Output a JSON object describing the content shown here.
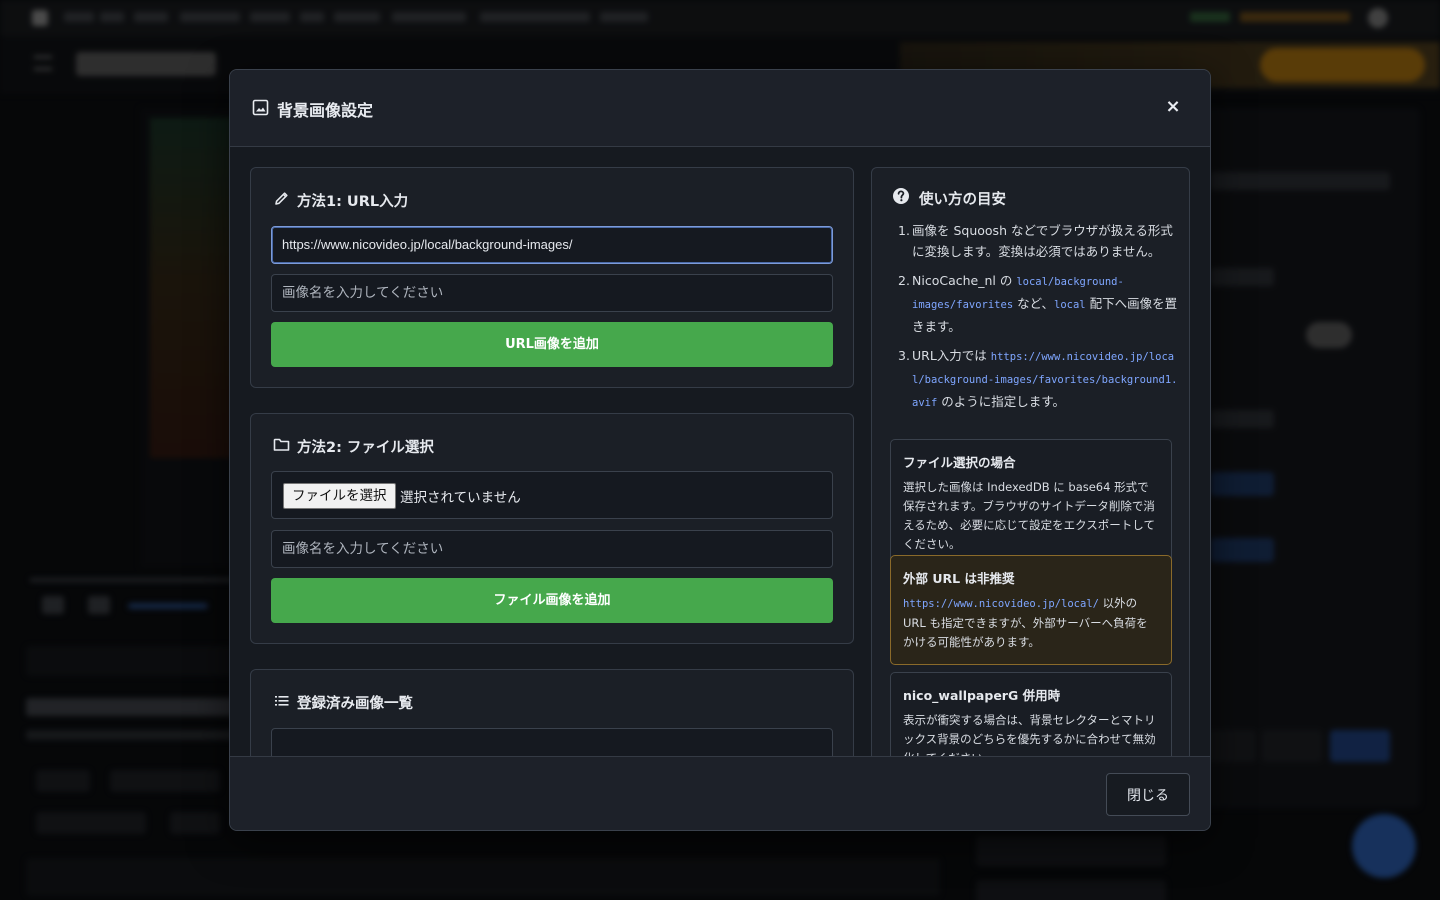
{
  "modal": {
    "title": "背景画像設定",
    "close_icon": "×",
    "footer_close_label": "閉じる"
  },
  "method1": {
    "title": "方法1: URL入力",
    "url_value": "https://www.nicovideo.jp/local/background-images/",
    "name_placeholder": "画像名を入力してください",
    "add_button": "URL画像を追加"
  },
  "method2": {
    "title": "方法2: ファイル選択",
    "file_button": "ファイルを選択",
    "file_status": "選択されていません",
    "name_placeholder": "画像名を入力してください",
    "add_button": "ファイル画像を追加"
  },
  "registered": {
    "title": "登録済み画像一覧"
  },
  "guide": {
    "title": "使い方の目安",
    "steps": [
      {
        "num": "1.",
        "text": "画像を Squoosh などでブラウザが扱える形式に変換します。変換は必須ではありません。"
      },
      {
        "num": "2.",
        "pre": "NicoCache_nl の ",
        "code1": "local/background-images/favorites",
        "mid": " など、",
        "code2": "local",
        "post": " 配下へ画像を置きます。"
      },
      {
        "num": "3.",
        "pre": "URL入力では ",
        "code1": "https://www.nicovideo.jp/local/background-images/favorites/background1.avif",
        "post": " のように指定します。"
      }
    ],
    "notes": [
      {
        "title": "ファイル選択の場合",
        "text": "選択した画像は IndexedDB に base64 形式で保存されます。ブラウザのサイトデータ削除で消えるため、必要に応じて設定をエクスポートしてください。"
      },
      {
        "title": "外部 URL は非推奨",
        "code": "https://www.nicovideo.jp/local/",
        "text": " 以外の URL も指定できますが、外部サーバーへ負荷をかける可能性があります。"
      },
      {
        "title": "nico_wallpaperG 併用時",
        "text": "表示が衝突する場合は、背景セレクターとマトリックス背景のどちらを優先するかに合わせて無効化してください。"
      }
    ]
  },
  "colors": {
    "accent_green": "#46a84c",
    "focus_blue": "#7d9bd8",
    "code_blue": "#7fa6ff",
    "warn_border": "#8a6a2a"
  }
}
